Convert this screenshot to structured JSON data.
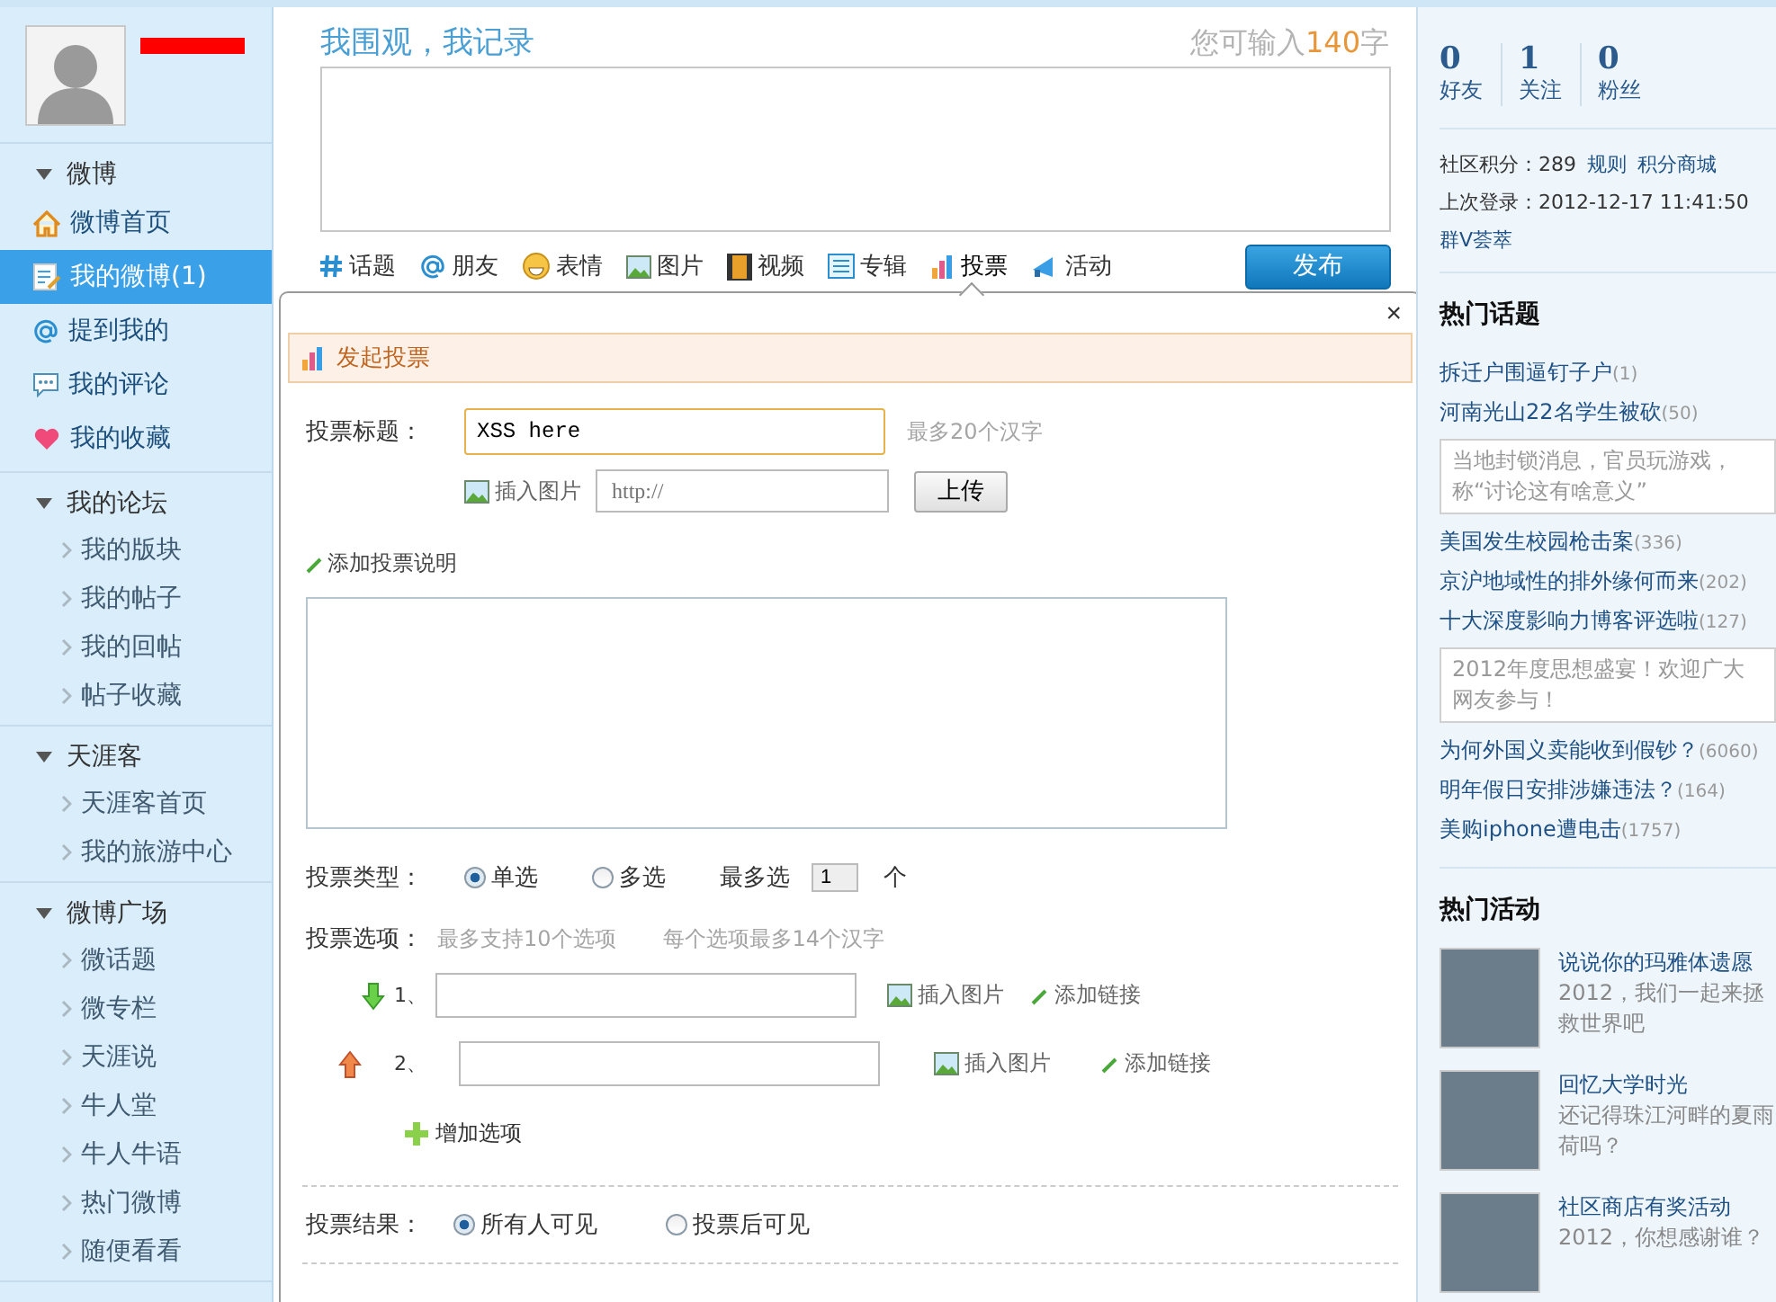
{
  "sidebar": {
    "sections": [
      {
        "title": "微博",
        "items": [
          {
            "label": "微博首页",
            "kind": "home",
            "selected": false
          },
          {
            "label": "我的微博(1)",
            "kind": "note",
            "selected": true
          },
          {
            "label": "提到我的",
            "kind": "at",
            "selected": false
          },
          {
            "label": "我的评论",
            "kind": "comment",
            "selected": false
          },
          {
            "label": "我的收藏",
            "kind": "heart",
            "selected": false
          }
        ]
      },
      {
        "title": "我的论坛",
        "items": [
          {
            "label": "我的版块",
            "kind": "chevron",
            "selected": false
          },
          {
            "label": "我的帖子",
            "kind": "chevron",
            "selected": false
          },
          {
            "label": "我的回帖",
            "kind": "chevron",
            "selected": false
          },
          {
            "label": "帖子收藏",
            "kind": "chevron",
            "selected": false
          }
        ]
      },
      {
        "title": "天涯客",
        "items": [
          {
            "label": "天涯客首页",
            "kind": "chevron",
            "selected": false
          },
          {
            "label": "我的旅游中心",
            "kind": "chevron",
            "selected": false
          }
        ]
      },
      {
        "title": "微博广场",
        "items": [
          {
            "label": "微话题",
            "kind": "chevron",
            "selected": false
          },
          {
            "label": "微专栏",
            "kind": "chevron",
            "selected": false
          },
          {
            "label": "天涯说",
            "kind": "chevron",
            "selected": false
          },
          {
            "label": "牛人堂",
            "kind": "chevron",
            "selected": false
          },
          {
            "label": "牛人牛语",
            "kind": "chevron",
            "selected": false
          },
          {
            "label": "热门微博",
            "kind": "chevron",
            "selected": false
          },
          {
            "label": "随便看看",
            "kind": "chevron",
            "selected": false
          }
        ]
      }
    ]
  },
  "composer": {
    "title": "我围观，我记录",
    "counter_prefix": "您可输入",
    "counter_number": "140",
    "counter_suffix": "字",
    "toolbar": [
      {
        "label": "话题",
        "kind": "hash",
        "selected": false
      },
      {
        "label": "朋友",
        "kind": "at",
        "selected": false
      },
      {
        "label": "表情",
        "kind": "smile",
        "selected": false
      },
      {
        "label": "图片",
        "kind": "image",
        "selected": false
      },
      {
        "label": "视频",
        "kind": "film",
        "selected": false
      },
      {
        "label": "专辑",
        "kind": "album",
        "selected": false
      },
      {
        "label": "投票",
        "kind": "chart",
        "selected": true
      },
      {
        "label": "活动",
        "kind": "megaphone",
        "selected": false
      }
    ],
    "publish": "发布"
  },
  "vote_panel": {
    "close": "×",
    "header": "发起投票",
    "title_label": "投票标题：",
    "title_value": "XSS here",
    "title_hint": "最多20个汉字",
    "insert_image": "插入图片",
    "url_placeholder": "http://",
    "upload": "上传",
    "add_description": "添加投票说明",
    "type_label": "投票类型：",
    "types": [
      {
        "label": "单选",
        "selected": true
      },
      {
        "label": "多选",
        "selected": false
      }
    ],
    "max_label": "最多选",
    "max_value": "1",
    "max_unit": "个",
    "options_label": "投票选项：",
    "options_hints": [
      "最多支持10个选项",
      "每个选项最多14个汉字"
    ],
    "choices": [
      {
        "number": "1、",
        "kind": "move_down",
        "insert_image": "插入图片",
        "add_link": "添加链接"
      },
      {
        "number": "2、",
        "kind": "move_up",
        "insert_image": "插入图片",
        "add_link": "添加链接"
      }
    ],
    "add_option": "增加选项",
    "result_label": "投票结果：",
    "results": [
      {
        "label": "所有人可见",
        "selected": true
      },
      {
        "label": "投票后可见",
        "selected": false
      }
    ]
  },
  "profile": {
    "stats": [
      {
        "value": "0",
        "label": "好友"
      },
      {
        "value": "1",
        "label": "关注"
      },
      {
        "value": "0",
        "label": "粉丝"
      }
    ],
    "points_label": "社区积分：",
    "points": "289",
    "points_links": [
      "规则",
      "积分商城"
    ],
    "last_login_label": "上次登录：",
    "last_login": "2012-12-17 11:41:50",
    "group_link": "群V荟萃"
  },
  "hot_topics": {
    "title": "热门话题",
    "items": [
      {
        "title": "拆迁户围逼钉子户",
        "count": "(1)"
      },
      {
        "title": "河南光山22名学生被砍",
        "count": "(50)",
        "note": "当地封锁消息，官员玩游戏，称“讨论这有啥意义”"
      },
      {
        "title": "美国发生校园枪击案",
        "count": "(336)"
      },
      {
        "title": "京沪地域性的排外缘何而来",
        "count": "(202)"
      },
      {
        "title": "十大深度影响力博客评选啦",
        "count": "(127)",
        "note": "2012年度思想盛宴！欢迎广大网友参与！"
      },
      {
        "title": "为何外国义卖能收到假钞？",
        "count": "(6060)"
      },
      {
        "title": "明年假日安排涉嫌违法？",
        "count": "(164)"
      },
      {
        "title": "美购iphone遭电击",
        "count": "(1757)"
      }
    ]
  },
  "hot_activities": {
    "title": "热门活动",
    "items": [
      {
        "title": "说说你的玛雅体遗愿",
        "desc": "2012，我们一起来拯救世界吧"
      },
      {
        "title": "回忆大学时光",
        "desc": "还记得珠江河畔的夏雨荷吗？"
      },
      {
        "title": "社区商店有奖活动",
        "desc": "2012，你想感谢谁？"
      }
    ]
  }
}
